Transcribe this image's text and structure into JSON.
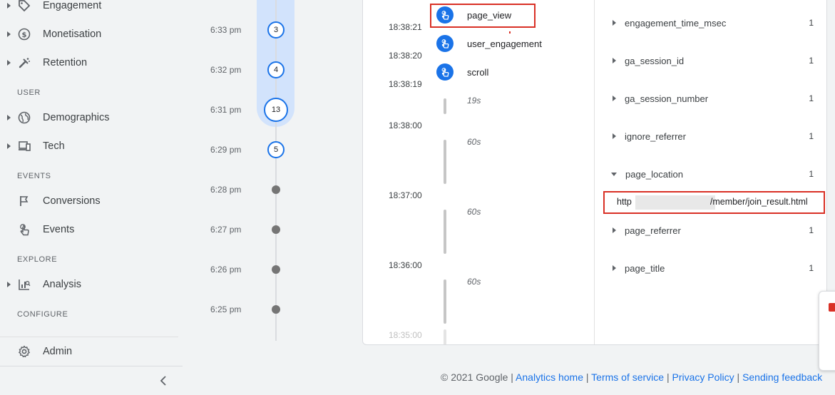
{
  "sidebar": {
    "items": [
      {
        "label": "Engagement",
        "icon": "tag-icon"
      },
      {
        "label": "Monetisation",
        "icon": "dollar-icon"
      },
      {
        "label": "Retention",
        "icon": "retention-icon"
      },
      {
        "label": "Demographics",
        "icon": "globe-icon"
      },
      {
        "label": "Tech",
        "icon": "devices-icon"
      },
      {
        "label": "Conversions",
        "icon": "flag-icon"
      },
      {
        "label": "Events",
        "icon": "touch-icon"
      },
      {
        "label": "Analysis",
        "icon": "analysis-icon"
      },
      {
        "label": "Admin",
        "icon": "gear-icon"
      }
    ],
    "sections": {
      "user": "USER",
      "events": "EVENTS",
      "explore": "EXPLORE",
      "configure": "CONFIGURE"
    }
  },
  "minutes": [
    {
      "time": "6:33 pm",
      "count": "3"
    },
    {
      "time": "6:32 pm",
      "count": "4"
    },
    {
      "time": "6:31 pm",
      "count": "13"
    },
    {
      "time": "6:29 pm",
      "count": "5"
    },
    {
      "time": "6:28 pm"
    },
    {
      "time": "6:27 pm"
    },
    {
      "time": "6:26 pm"
    },
    {
      "time": "6:25 pm"
    }
  ],
  "timestamps": [
    "18:38:21",
    "18:38:20",
    "18:38:19",
    "18:38:00",
    "18:37:00",
    "18:36:00",
    "18:35:00"
  ],
  "events": [
    {
      "name": "page_view",
      "selected": true
    },
    {
      "name": "user_engagement"
    },
    {
      "name": "scroll"
    }
  ],
  "gaps": [
    "19s",
    "60s",
    "60s",
    "60s"
  ],
  "params": [
    {
      "name": "engagement_time_msec",
      "count": "1"
    },
    {
      "name": "ga_session_id",
      "count": "1"
    },
    {
      "name": "ga_session_number",
      "count": "1"
    },
    {
      "name": "ignore_referrer",
      "count": "1"
    },
    {
      "name": "page_location",
      "count": "1",
      "expanded": true
    },
    {
      "name": "page_referrer",
      "count": "1"
    },
    {
      "name": "page_title",
      "count": "1"
    }
  ],
  "page_location_value": {
    "prefix": "http",
    "suffix": "/member/join_result.html"
  },
  "footer": {
    "copyright": "© 2021 Google",
    "links": [
      "Analytics home",
      "Terms of service",
      "Privacy Policy",
      "Sending feedback"
    ]
  },
  "colors": {
    "accent": "#1a73e8",
    "highlight": "#d93025",
    "minute_highlight": "#d2e3fc"
  }
}
